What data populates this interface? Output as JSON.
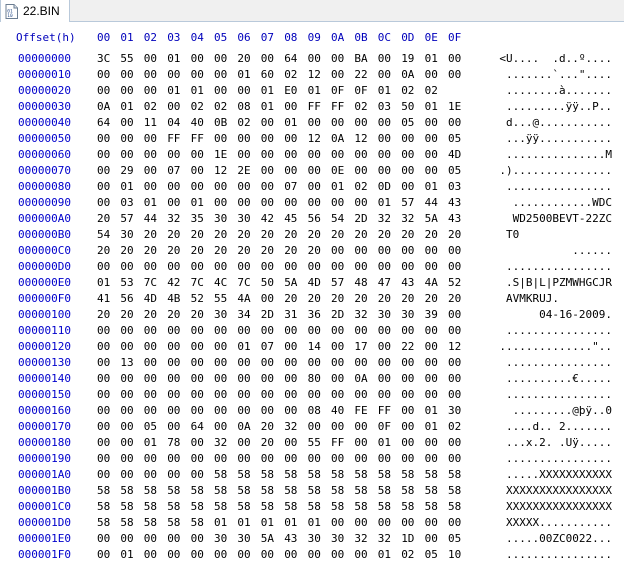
{
  "tab": {
    "icon": "binary-file-icon",
    "title": "22.BIN"
  },
  "header": {
    "offset_label": "Offset(h)",
    "columns": [
      "00",
      "01",
      "02",
      "03",
      "04",
      "05",
      "06",
      "07",
      "08",
      "09",
      "0A",
      "0B",
      "0C",
      "0D",
      "0E",
      "0F"
    ]
  },
  "colors": {
    "offset": "#0000cc",
    "header": "#0000bb",
    "bytes": "#000000"
  },
  "rows": [
    {
      "offset": "00000000",
      "bytes": [
        "3C",
        "55",
        "00",
        "01",
        "00",
        "00",
        "20",
        "00",
        "64",
        "00",
        "00",
        "BA",
        "00",
        "19",
        "01",
        "00"
      ],
      "ascii": "<U....  .d..º...."
    },
    {
      "offset": "00000010",
      "bytes": [
        "00",
        "00",
        "00",
        "00",
        "00",
        "00",
        "01",
        "60",
        "02",
        "12",
        "00",
        "22",
        "00",
        "0A",
        "00",
        "00"
      ],
      "ascii": ".......`...\"...."
    },
    {
      "offset": "00000020",
      "bytes": [
        "00",
        "00",
        "00",
        "01",
        "01",
        "00",
        "00",
        "01",
        "E0",
        "01",
        "0F",
        "0F",
        "01",
        "02",
        "02"
      ],
      "ascii": "........à......."
    },
    {
      "offset": "00000030",
      "bytes": [
        "0A",
        "01",
        "02",
        "00",
        "02",
        "02",
        "08",
        "01",
        "00",
        "FF",
        "FF",
        "02",
        "03",
        "50",
        "01",
        "1E"
      ],
      "ascii": ".........ÿÿ..P.."
    },
    {
      "offset": "00000040",
      "bytes": [
        "64",
        "00",
        "11",
        "04",
        "40",
        "0B",
        "02",
        "00",
        "01",
        "00",
        "00",
        "00",
        "00",
        "05",
        "00",
        "00"
      ],
      "ascii": "d...@..........."
    },
    {
      "offset": "00000050",
      "bytes": [
        "00",
        "00",
        "00",
        "FF",
        "FF",
        "00",
        "00",
        "00",
        "00",
        "12",
        "0A",
        "12",
        "00",
        "00",
        "00",
        "05"
      ],
      "ascii": "...ÿÿ..........."
    },
    {
      "offset": "00000060",
      "bytes": [
        "00",
        "00",
        "00",
        "00",
        "00",
        "1E",
        "00",
        "00",
        "00",
        "00",
        "00",
        "00",
        "00",
        "00",
        "00",
        "4D"
      ],
      "ascii": "...............M"
    },
    {
      "offset": "00000070",
      "bytes": [
        "00",
        "29",
        "00",
        "07",
        "00",
        "12",
        "2E",
        "00",
        "00",
        "00",
        "0E",
        "00",
        "00",
        "00",
        "00",
        "05"
      ],
      "ascii": ".)..............."
    },
    {
      "offset": "00000080",
      "bytes": [
        "00",
        "01",
        "00",
        "00",
        "00",
        "00",
        "00",
        "00",
        "07",
        "00",
        "01",
        "02",
        "0D",
        "00",
        "01",
        "03"
      ],
      "ascii": "................"
    },
    {
      "offset": "00000090",
      "bytes": [
        "00",
        "03",
        "01",
        "00",
        "01",
        "00",
        "00",
        "00",
        "00",
        "00",
        "00",
        "00",
        "01",
        "57",
        "44",
        "43"
      ],
      "ascii": "............WDC"
    },
    {
      "offset": "000000A0",
      "bytes": [
        "20",
        "57",
        "44",
        "32",
        "35",
        "30",
        "30",
        "42",
        "45",
        "56",
        "54",
        "2D",
        "32",
        "32",
        "5A",
        "43"
      ],
      "ascii": " WD2500BEVT-22ZC"
    },
    {
      "offset": "000000B0",
      "bytes": [
        "54",
        "30",
        "20",
        "20",
        "20",
        "20",
        "20",
        "20",
        "20",
        "20",
        "20",
        "20",
        "20",
        "20",
        "20",
        "20"
      ],
      "ascii": "T0              "
    },
    {
      "offset": "000000C0",
      "bytes": [
        "20",
        "20",
        "20",
        "20",
        "20",
        "20",
        "20",
        "20",
        "20",
        "20",
        "00",
        "00",
        "00",
        "00",
        "00",
        "00"
      ],
      "ascii": "          ......"
    },
    {
      "offset": "000000D0",
      "bytes": [
        "00",
        "00",
        "00",
        "00",
        "00",
        "00",
        "00",
        "00",
        "00",
        "00",
        "00",
        "00",
        "00",
        "00",
        "00",
        "00"
      ],
      "ascii": "................"
    },
    {
      "offset": "000000E0",
      "bytes": [
        "01",
        "53",
        "7C",
        "42",
        "7C",
        "4C",
        "7C",
        "50",
        "5A",
        "4D",
        "57",
        "48",
        "47",
        "43",
        "4A",
        "52"
      ],
      "ascii": ".S|B|L|PZMWHGCJR"
    },
    {
      "offset": "000000F0",
      "bytes": [
        "41",
        "56",
        "4D",
        "4B",
        "52",
        "55",
        "4A",
        "00",
        "20",
        "20",
        "20",
        "20",
        "20",
        "20",
        "20",
        "20"
      ],
      "ascii": "AVMKRUJ.        "
    },
    {
      "offset": "00000100",
      "bytes": [
        "20",
        "20",
        "20",
        "20",
        "20",
        "30",
        "34",
        "2D",
        "31",
        "36",
        "2D",
        "32",
        "30",
        "30",
        "39",
        "00"
      ],
      "ascii": "     04-16-2009."
    },
    {
      "offset": "00000110",
      "bytes": [
        "00",
        "00",
        "00",
        "00",
        "00",
        "00",
        "00",
        "00",
        "00",
        "00",
        "00",
        "00",
        "00",
        "00",
        "00",
        "00"
      ],
      "ascii": "................"
    },
    {
      "offset": "00000120",
      "bytes": [
        "00",
        "00",
        "00",
        "00",
        "00",
        "00",
        "01",
        "07",
        "00",
        "14",
        "00",
        "17",
        "00",
        "22",
        "00",
        "12"
      ],
      "ascii": "..............\".."
    },
    {
      "offset": "00000130",
      "bytes": [
        "00",
        "13",
        "00",
        "00",
        "00",
        "00",
        "00",
        "00",
        "00",
        "00",
        "00",
        "00",
        "00",
        "00",
        "00",
        "00"
      ],
      "ascii": "................"
    },
    {
      "offset": "00000140",
      "bytes": [
        "00",
        "00",
        "00",
        "00",
        "00",
        "00",
        "00",
        "00",
        "00",
        "80",
        "00",
        "0A",
        "00",
        "00",
        "00",
        "00"
      ],
      "ascii": "..........€....."
    },
    {
      "offset": "00000150",
      "bytes": [
        "00",
        "00",
        "00",
        "00",
        "00",
        "00",
        "00",
        "00",
        "00",
        "00",
        "00",
        "00",
        "00",
        "00",
        "00",
        "00"
      ],
      "ascii": "................"
    },
    {
      "offset": "00000160",
      "bytes": [
        "00",
        "00",
        "00",
        "00",
        "00",
        "00",
        "00",
        "00",
        "00",
        "08",
        "40",
        "FE",
        "FF",
        "00",
        "01",
        "30"
      ],
      "ascii": ".........@þÿ..0"
    },
    {
      "offset": "00000170",
      "bytes": [
        "00",
        "00",
        "05",
        "00",
        "64",
        "00",
        "0A",
        "20",
        "32",
        "00",
        "00",
        "00",
        "0F",
        "00",
        "01",
        "02"
      ],
      "ascii": "....d.. 2......."
    },
    {
      "offset": "00000180",
      "bytes": [
        "00",
        "00",
        "01",
        "78",
        "00",
        "32",
        "00",
        "20",
        "00",
        "55",
        "FF",
        "00",
        "01",
        "00",
        "00",
        "00"
      ],
      "ascii": "...x.2. .Uÿ....."
    },
    {
      "offset": "00000190",
      "bytes": [
        "00",
        "00",
        "00",
        "00",
        "00",
        "00",
        "00",
        "00",
        "00",
        "00",
        "00",
        "00",
        "00",
        "00",
        "00",
        "00"
      ],
      "ascii": "................"
    },
    {
      "offset": "000001A0",
      "bytes": [
        "00",
        "00",
        "00",
        "00",
        "00",
        "58",
        "58",
        "58",
        "58",
        "58",
        "58",
        "58",
        "58",
        "58",
        "58",
        "58"
      ],
      "ascii": ".....XXXXXXXXXXX"
    },
    {
      "offset": "000001B0",
      "bytes": [
        "58",
        "58",
        "58",
        "58",
        "58",
        "58",
        "58",
        "58",
        "58",
        "58",
        "58",
        "58",
        "58",
        "58",
        "58",
        "58"
      ],
      "ascii": "XXXXXXXXXXXXXXXX"
    },
    {
      "offset": "000001C0",
      "bytes": [
        "58",
        "58",
        "58",
        "58",
        "58",
        "58",
        "58",
        "58",
        "58",
        "58",
        "58",
        "58",
        "58",
        "58",
        "58",
        "58"
      ],
      "ascii": "XXXXXXXXXXXXXXXX"
    },
    {
      "offset": "000001D0",
      "bytes": [
        "58",
        "58",
        "58",
        "58",
        "58",
        "01",
        "01",
        "01",
        "01",
        "01",
        "00",
        "00",
        "00",
        "00",
        "00",
        "00"
      ],
      "ascii": "XXXXX..........."
    },
    {
      "offset": "000001E0",
      "bytes": [
        "00",
        "00",
        "00",
        "00",
        "00",
        "30",
        "30",
        "5A",
        "43",
        "30",
        "30",
        "32",
        "32",
        "1D",
        "00",
        "05"
      ],
      "ascii": ".....00ZC0022..."
    },
    {
      "offset": "000001F0",
      "bytes": [
        "00",
        "01",
        "00",
        "00",
        "00",
        "00",
        "00",
        "00",
        "00",
        "00",
        "00",
        "00",
        "01",
        "02",
        "05",
        "10"
      ],
      "ascii": "................"
    }
  ]
}
